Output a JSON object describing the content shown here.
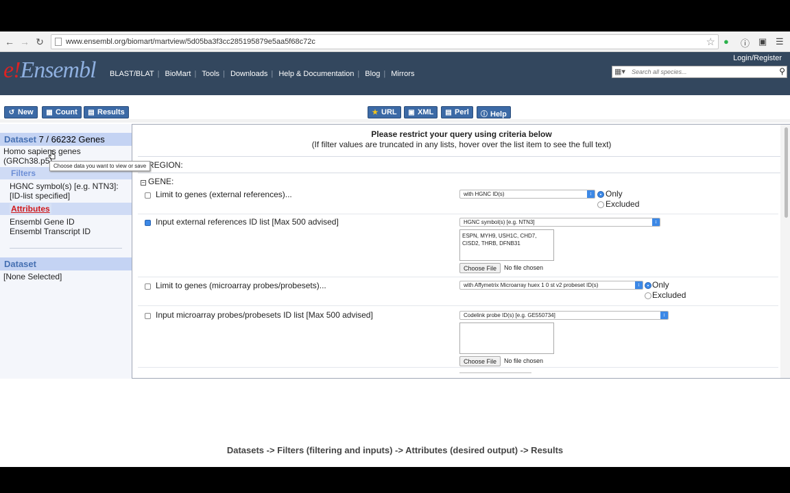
{
  "browser": {
    "url": "www.ensembl.org/biomart/martview/5d05ba3f3cc285195879e5aa5f68c72c"
  },
  "header": {
    "logo_e": "e",
    "logo_text": "Ensembl",
    "nav": [
      "BLAST/BLAT",
      "BioMart",
      "Tools",
      "Downloads",
      "Help & Documentation",
      "Blog",
      "Mirrors"
    ],
    "login": "Login/Register",
    "search_placeholder": "Search all species..."
  },
  "toolbar": {
    "new": "New",
    "count": "Count",
    "results": "Results",
    "url": "URL",
    "xml": "XML",
    "perl": "Perl",
    "help": "Help"
  },
  "left": {
    "dataset_label": "Dataset",
    "dataset_count": "7 / 66232 Genes",
    "species_line1": "Homo sapiens genes",
    "species_line2": "(GRCh38.p5)",
    "filters_label": "Filters",
    "filter_summary_line1": "HGNC symbol(s) [e.g. NTN3]:",
    "filter_summary_line2": "[ID-list specified]",
    "attributes_label": "Attributes",
    "attr_line1": "Ensembl Gene ID",
    "attr_line2": "Ensembl Transcript ID",
    "tooltip": "Choose data you want to view or save",
    "dataset2_label": "Dataset",
    "none_selected": "[None Selected]"
  },
  "main": {
    "title": "Please restrict your query using criteria below",
    "subtitle": "(If filter values are truncated in any lists, hover over the list item to see the full text)",
    "region": "REGION:",
    "gene": "GENE:",
    "rows": {
      "limit_ext_label": "Limit to genes (external references)...",
      "limit_ext_select": "with HGNC ID(s)",
      "only": "Only",
      "excluded": "Excluded",
      "input_ext_label": "Input external references ID list [Max 500 advised]",
      "input_ext_select": "HGNC symbol(s) [e.g. NTN3]",
      "input_ext_text": "ESPN, MYH9, USH1C, CHD7,\nCISD2, THRB, DFNB31",
      "choose_file": "Choose File",
      "no_file": "No file chosen",
      "limit_micro_label": "Limit to genes (microarray probes/probesets)...",
      "limit_micro_select": "with Affymetrix Microarray huex 1 0 st v2 probeset ID(s)",
      "input_micro_label": "Input microarray probes/probesets ID list [Max 500 advised]",
      "input_micro_select": "Codelink probe ID(s) [e.g. GE550734]"
    }
  },
  "caption": "Datasets -> Filters (filtering and inputs) -> Attributes (desired output) -> Results"
}
